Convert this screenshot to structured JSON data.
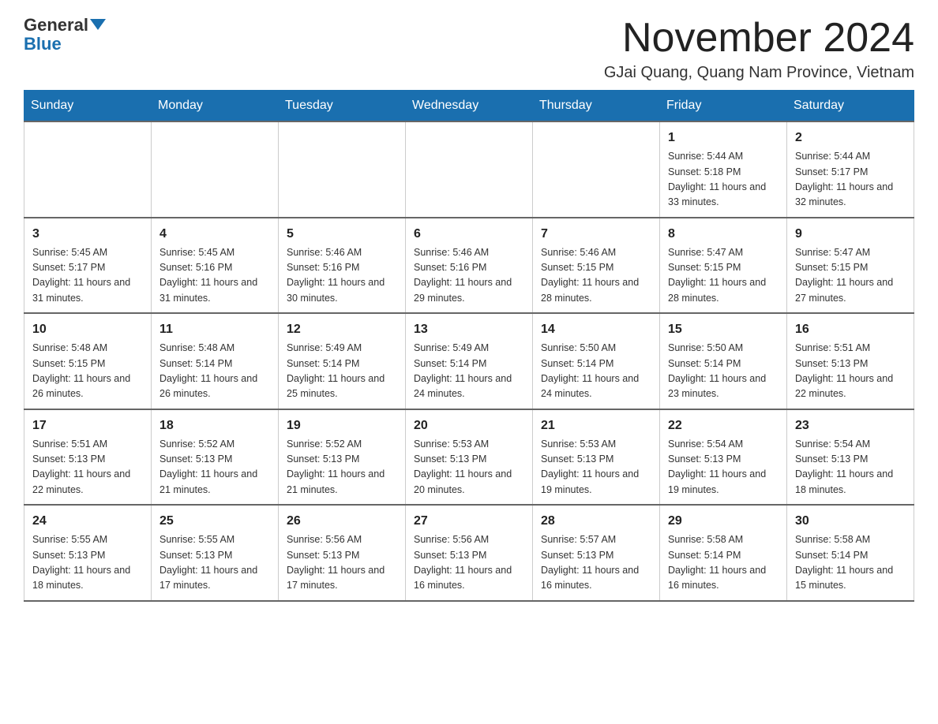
{
  "logo": {
    "general": "General",
    "blue": "Blue"
  },
  "title": "November 2024",
  "location": "GJai Quang, Quang Nam Province, Vietnam",
  "days_of_week": [
    "Sunday",
    "Monday",
    "Tuesday",
    "Wednesday",
    "Thursday",
    "Friday",
    "Saturday"
  ],
  "weeks": [
    [
      {
        "day": "",
        "info": ""
      },
      {
        "day": "",
        "info": ""
      },
      {
        "day": "",
        "info": ""
      },
      {
        "day": "",
        "info": ""
      },
      {
        "day": "",
        "info": ""
      },
      {
        "day": "1",
        "info": "Sunrise: 5:44 AM\nSunset: 5:18 PM\nDaylight: 11 hours and 33 minutes."
      },
      {
        "day": "2",
        "info": "Sunrise: 5:44 AM\nSunset: 5:17 PM\nDaylight: 11 hours and 32 minutes."
      }
    ],
    [
      {
        "day": "3",
        "info": "Sunrise: 5:45 AM\nSunset: 5:17 PM\nDaylight: 11 hours and 31 minutes."
      },
      {
        "day": "4",
        "info": "Sunrise: 5:45 AM\nSunset: 5:16 PM\nDaylight: 11 hours and 31 minutes."
      },
      {
        "day": "5",
        "info": "Sunrise: 5:46 AM\nSunset: 5:16 PM\nDaylight: 11 hours and 30 minutes."
      },
      {
        "day": "6",
        "info": "Sunrise: 5:46 AM\nSunset: 5:16 PM\nDaylight: 11 hours and 29 minutes."
      },
      {
        "day": "7",
        "info": "Sunrise: 5:46 AM\nSunset: 5:15 PM\nDaylight: 11 hours and 28 minutes."
      },
      {
        "day": "8",
        "info": "Sunrise: 5:47 AM\nSunset: 5:15 PM\nDaylight: 11 hours and 28 minutes."
      },
      {
        "day": "9",
        "info": "Sunrise: 5:47 AM\nSunset: 5:15 PM\nDaylight: 11 hours and 27 minutes."
      }
    ],
    [
      {
        "day": "10",
        "info": "Sunrise: 5:48 AM\nSunset: 5:15 PM\nDaylight: 11 hours and 26 minutes."
      },
      {
        "day": "11",
        "info": "Sunrise: 5:48 AM\nSunset: 5:14 PM\nDaylight: 11 hours and 26 minutes."
      },
      {
        "day": "12",
        "info": "Sunrise: 5:49 AM\nSunset: 5:14 PM\nDaylight: 11 hours and 25 minutes."
      },
      {
        "day": "13",
        "info": "Sunrise: 5:49 AM\nSunset: 5:14 PM\nDaylight: 11 hours and 24 minutes."
      },
      {
        "day": "14",
        "info": "Sunrise: 5:50 AM\nSunset: 5:14 PM\nDaylight: 11 hours and 24 minutes."
      },
      {
        "day": "15",
        "info": "Sunrise: 5:50 AM\nSunset: 5:14 PM\nDaylight: 11 hours and 23 minutes."
      },
      {
        "day": "16",
        "info": "Sunrise: 5:51 AM\nSunset: 5:13 PM\nDaylight: 11 hours and 22 minutes."
      }
    ],
    [
      {
        "day": "17",
        "info": "Sunrise: 5:51 AM\nSunset: 5:13 PM\nDaylight: 11 hours and 22 minutes."
      },
      {
        "day": "18",
        "info": "Sunrise: 5:52 AM\nSunset: 5:13 PM\nDaylight: 11 hours and 21 minutes."
      },
      {
        "day": "19",
        "info": "Sunrise: 5:52 AM\nSunset: 5:13 PM\nDaylight: 11 hours and 21 minutes."
      },
      {
        "day": "20",
        "info": "Sunrise: 5:53 AM\nSunset: 5:13 PM\nDaylight: 11 hours and 20 minutes."
      },
      {
        "day": "21",
        "info": "Sunrise: 5:53 AM\nSunset: 5:13 PM\nDaylight: 11 hours and 19 minutes."
      },
      {
        "day": "22",
        "info": "Sunrise: 5:54 AM\nSunset: 5:13 PM\nDaylight: 11 hours and 19 minutes."
      },
      {
        "day": "23",
        "info": "Sunrise: 5:54 AM\nSunset: 5:13 PM\nDaylight: 11 hours and 18 minutes."
      }
    ],
    [
      {
        "day": "24",
        "info": "Sunrise: 5:55 AM\nSunset: 5:13 PM\nDaylight: 11 hours and 18 minutes."
      },
      {
        "day": "25",
        "info": "Sunrise: 5:55 AM\nSunset: 5:13 PM\nDaylight: 11 hours and 17 minutes."
      },
      {
        "day": "26",
        "info": "Sunrise: 5:56 AM\nSunset: 5:13 PM\nDaylight: 11 hours and 17 minutes."
      },
      {
        "day": "27",
        "info": "Sunrise: 5:56 AM\nSunset: 5:13 PM\nDaylight: 11 hours and 16 minutes."
      },
      {
        "day": "28",
        "info": "Sunrise: 5:57 AM\nSunset: 5:13 PM\nDaylight: 11 hours and 16 minutes."
      },
      {
        "day": "29",
        "info": "Sunrise: 5:58 AM\nSunset: 5:14 PM\nDaylight: 11 hours and 16 minutes."
      },
      {
        "day": "30",
        "info": "Sunrise: 5:58 AM\nSunset: 5:14 PM\nDaylight: 11 hours and 15 minutes."
      }
    ]
  ]
}
